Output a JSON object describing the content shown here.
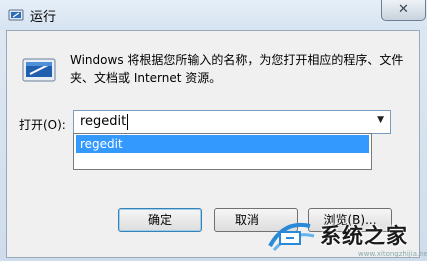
{
  "window": {
    "title": "运行",
    "close_glyph": "✕"
  },
  "dialog": {
    "description": "Windows 将根据您所输入的名称，为您打开相应的程序、文件夹、文档或 Internet 资源。",
    "open_label": "打开(O):",
    "open_value": "regedit",
    "dropdown_items": [
      "regedit"
    ],
    "buttons": {
      "ok": "确定",
      "cancel": "取消",
      "browse": "浏览(B)..."
    }
  },
  "watermark": {
    "text": "系统之家",
    "url": "www.xitongzhijia.net"
  },
  "colors": {
    "selection": "#3399ff",
    "window_frame": "#dfe9f3",
    "client": "#f0f0f0"
  },
  "icons": [
    "run-app-icon",
    "run-program-icon",
    "dropdown-arrow-icon",
    "close-icon",
    "watermark-logo-icon"
  ]
}
